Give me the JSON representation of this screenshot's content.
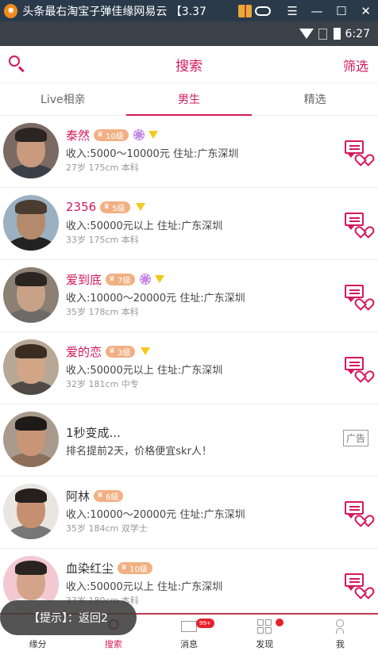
{
  "emulator": {
    "logo_glyph": "✸",
    "title": "头条最右淘宝子弹佳缘网易云 【3.37",
    "menu_glyph": "☰",
    "minimize_glyph": "—",
    "maximize_glyph": "☐",
    "close_glyph": "✕"
  },
  "status_bar": {
    "time": "6:27"
  },
  "header": {
    "title": "搜索",
    "filter_label": "筛选"
  },
  "tabs": [
    {
      "label": "Live相亲",
      "active": false
    },
    {
      "label": "男生",
      "active": true
    },
    {
      "label": "精选",
      "active": false
    }
  ],
  "users": [
    {
      "name": "泰然",
      "level": "10级",
      "income": "收入:5000～10000元",
      "address": "住址:广东深圳",
      "age": "27岁",
      "height": "175cm",
      "education": "本科",
      "flower": true,
      "gem": true
    },
    {
      "name": "2356",
      "level": "5级",
      "income": "收入:50000元以上",
      "address": "住址:广东深圳",
      "age": "33岁",
      "height": "175cm",
      "education": "本科",
      "flower": false,
      "gem": true
    },
    {
      "name": "爱到底",
      "level": "7级",
      "income": "收入:10000～20000元",
      "address": "住址:广东深圳",
      "age": "35岁",
      "height": "178cm",
      "education": "本科",
      "flower": true,
      "gem": true
    },
    {
      "name": "爱的恋",
      "level": "3级",
      "income": "收入:50000元以上",
      "address": "住址:广东深圳",
      "age": "32岁",
      "height": "181cm",
      "education": "中专",
      "flower": false,
      "gem": true
    }
  ],
  "ad": {
    "title": "1秒变成...",
    "desc": "排名提前2天，价格便宜skr人！",
    "tag": "广告"
  },
  "users2": [
    {
      "name": "阿林",
      "level": "6级",
      "income": "收入:10000～20000元",
      "address": "住址:广东深圳",
      "age": "35岁",
      "height": "184cm",
      "education": "双学士"
    },
    {
      "name": "血染红尘",
      "level": "10级",
      "income": "收入:50000元以上",
      "address": "住址:广东深圳",
      "age": "33岁",
      "height": "180cm",
      "education": "本科"
    }
  ],
  "bottom_nav": [
    {
      "label": "缘分"
    },
    {
      "label": "搜索"
    },
    {
      "label": "消息",
      "badge": "99+"
    },
    {
      "label": "发现"
    },
    {
      "label": "我"
    }
  ],
  "toast": "【提示】：返回2",
  "colors": {
    "accent": "#d5195a",
    "level_badge": "#f1b083",
    "gem": "#f4c91d",
    "flower": "#c78ae6"
  }
}
